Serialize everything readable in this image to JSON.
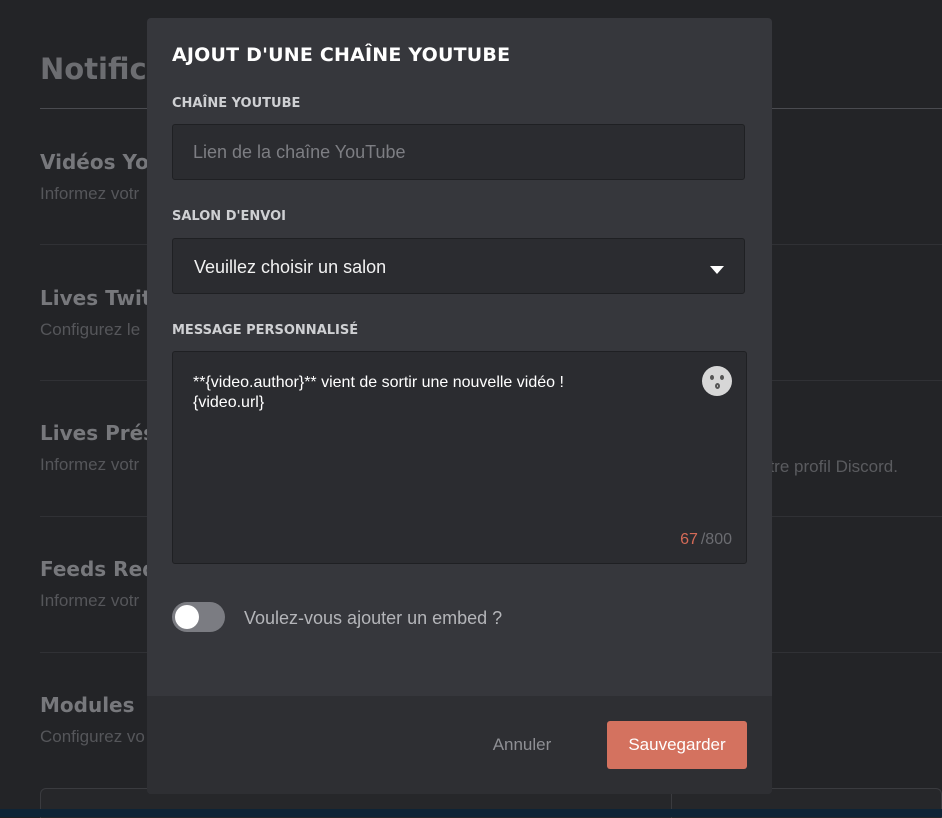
{
  "background": {
    "title": "Notificati",
    "sections": [
      {
        "heading": "Vidéos You",
        "desc": "Informez votr"
      },
      {
        "heading": "Lives Twitc",
        "desc": "Configurez le"
      },
      {
        "heading": "Lives Prése",
        "desc": "Informez votr"
      },
      {
        "heading": "Feeds Redd",
        "desc": "Informez votr"
      },
      {
        "heading": "Modules",
        "desc": "Configurez vo"
      }
    ],
    "right_fragment": "otre profil Discord."
  },
  "modal": {
    "title": "AJOUT D'UNE CHAÎNE YOUTUBE",
    "channel": {
      "label": "CHAÎNE YOUTUBE",
      "placeholder": "Lien de la chaîne YouTube",
      "value": ""
    },
    "salon": {
      "label": "SALON D'ENVOI",
      "selected": "Veuillez choisir un salon"
    },
    "message": {
      "label": "MESSAGE PERSONNALISÉ",
      "text": "**{video.author}** vient de sortir une nouvelle vidéo !\n{video.url}",
      "count": "67",
      "max": "/800",
      "emoji_icon": "kissing-face-icon"
    },
    "embed": {
      "label": "Voulez-vous ajouter un embed ?",
      "enabled": false
    },
    "footer": {
      "cancel_label": "Annuler",
      "save_label": "Sauvegarder"
    }
  },
  "colors": {
    "accent": "#d4725f",
    "counter_current": "#d46a57",
    "modal_bg": "#36373c",
    "field_bg": "#2b2c30"
  }
}
